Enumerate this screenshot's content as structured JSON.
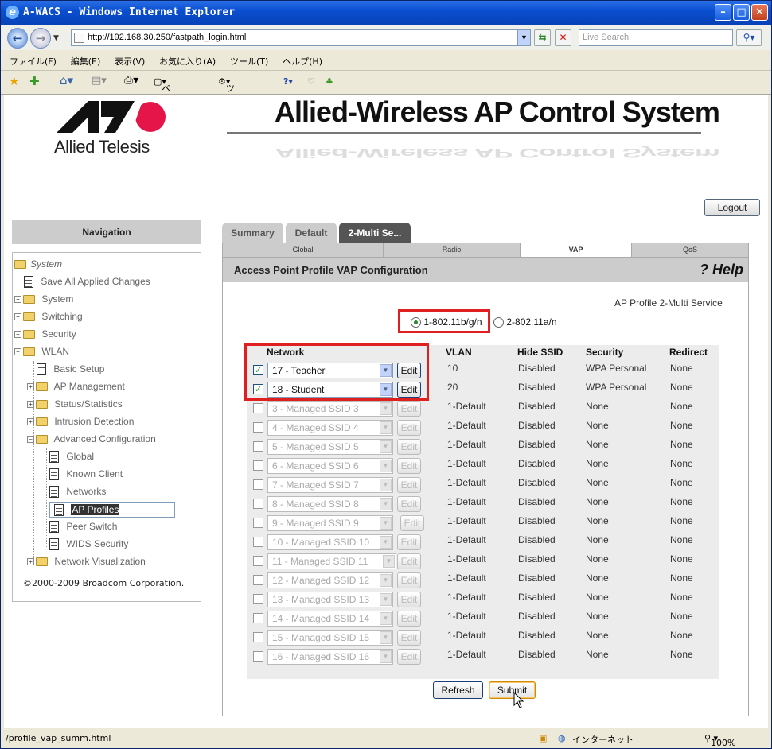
{
  "window": {
    "title": "A-WACS - Windows Internet Explorer"
  },
  "browser": {
    "url": "http://192.168.30.250/fastpath_login.html",
    "search_placeholder": "Live Search",
    "menu": [
      "ファイル(F)",
      "編集(E)",
      "表示(V)",
      "お気に入り(A)",
      "ツール(T)",
      "ヘルプ(H)"
    ],
    "toolbar": {
      "page_label": "ページ(P)",
      "tools_label": "ツール(O)"
    }
  },
  "header": {
    "brand": "Allied Telesis",
    "system_title": "Allied-Wireless AP Control System",
    "logout_label": "Logout"
  },
  "nav": {
    "title": "Navigation",
    "root": "System",
    "items": [
      {
        "label": "Save All Applied Changes"
      },
      {
        "label": "System"
      },
      {
        "label": "Switching"
      },
      {
        "label": "Security"
      },
      {
        "label": "WLAN"
      },
      {
        "label": "Basic Setup"
      },
      {
        "label": "AP Management"
      },
      {
        "label": "Status/Statistics"
      },
      {
        "label": "Intrusion Detection"
      },
      {
        "label": "Advanced Configuration"
      },
      {
        "label": "Global"
      },
      {
        "label": "Known Client"
      },
      {
        "label": "Networks"
      },
      {
        "label": "AP Profiles"
      },
      {
        "label": "Peer Switch"
      },
      {
        "label": "WIDS Security"
      },
      {
        "label": "Network Visualization"
      }
    ],
    "copyright": "©2000-2009 Broadcom Corporation."
  },
  "tabs": [
    "Summary",
    "Default",
    "2-Multi Se..."
  ],
  "subtabs": [
    "Global",
    "Radio",
    "VAP",
    "QoS"
  ],
  "panel": {
    "title": "Access Point Profile VAP Configuration",
    "help": "? Help",
    "profile_name": "AP Profile 2-Multi Service",
    "radio1": "1-802.11b/g/n",
    "radio2": "2-802.11a/n"
  },
  "table": {
    "headers": {
      "network": "Network",
      "vlan": "VLAN",
      "hide_ssid": "Hide SSID",
      "security": "Security",
      "redirect": "Redirect"
    },
    "edit_label": "Edit",
    "rows": [
      {
        "network": "17 - Teacher",
        "vlan": "10",
        "hide": "Disabled",
        "security": "WPA Personal",
        "redirect": "None"
      },
      {
        "network": "18 - Student",
        "vlan": "20",
        "hide": "Disabled",
        "security": "WPA Personal",
        "redirect": "None"
      },
      {
        "network": "3 - Managed SSID 3",
        "vlan": "1-Default",
        "hide": "Disabled",
        "security": "None",
        "redirect": "None"
      },
      {
        "network": "4 - Managed SSID 4",
        "vlan": "1-Default",
        "hide": "Disabled",
        "security": "None",
        "redirect": "None"
      },
      {
        "network": "5 - Managed SSID 5",
        "vlan": "1-Default",
        "hide": "Disabled",
        "security": "None",
        "redirect": "None"
      },
      {
        "network": "6 - Managed SSID 6",
        "vlan": "1-Default",
        "hide": "Disabled",
        "security": "None",
        "redirect": "None"
      },
      {
        "network": "7 - Managed SSID 7",
        "vlan": "1-Default",
        "hide": "Disabled",
        "security": "None",
        "redirect": "None"
      },
      {
        "network": "8 - Managed SSID 8",
        "vlan": "1-Default",
        "hide": "Disabled",
        "security": "None",
        "redirect": "None"
      },
      {
        "network": "9 - Managed SSID 9",
        "vlan": "1-Default",
        "hide": "Disabled",
        "security": "None",
        "redirect": "None"
      },
      {
        "network": "10 - Managed SSID 10",
        "vlan": "1-Default",
        "hide": "Disabled",
        "security": "None",
        "redirect": "None"
      },
      {
        "network": "11 - Managed SSID 11",
        "vlan": "1-Default",
        "hide": "Disabled",
        "security": "None",
        "redirect": "None"
      },
      {
        "network": "12 - Managed SSID 12",
        "vlan": "1-Default",
        "hide": "Disabled",
        "security": "None",
        "redirect": "None"
      },
      {
        "network": "13 - Managed SSID 13",
        "vlan": "1-Default",
        "hide": "Disabled",
        "security": "None",
        "redirect": "None"
      },
      {
        "network": "14 - Managed SSID 14",
        "vlan": "1-Default",
        "hide": "Disabled",
        "security": "None",
        "redirect": "None"
      },
      {
        "network": "15 - Managed SSID 15",
        "vlan": "1-Default",
        "hide": "Disabled",
        "security": "None",
        "redirect": "None"
      },
      {
        "network": "16 - Managed SSID 16",
        "vlan": "1-Default",
        "hide": "Disabled",
        "security": "None",
        "redirect": "None"
      }
    ]
  },
  "buttons": {
    "refresh": "Refresh",
    "submit": "Submit"
  },
  "statusbar": {
    "text": "/profile_vap_summ.html",
    "zone": "インターネット",
    "zoom": "100%"
  },
  "colors": {
    "highlight_box": "#e02020",
    "active_tab": "#555555"
  }
}
